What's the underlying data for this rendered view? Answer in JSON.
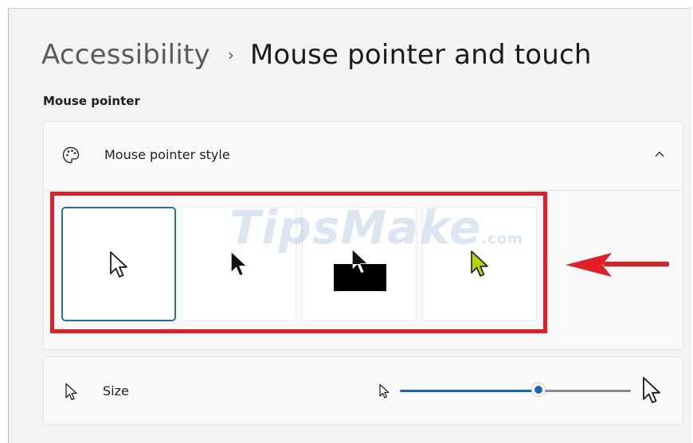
{
  "breadcrumb": {
    "parent": "Accessibility",
    "separator": "›",
    "current": "Mouse pointer and touch"
  },
  "section": {
    "label": "Mouse pointer"
  },
  "pointer_style": {
    "title": "Mouse pointer style",
    "icon": "palette-icon",
    "expanded": true,
    "options": [
      {
        "name": "white",
        "selected": true
      },
      {
        "name": "black",
        "selected": false
      },
      {
        "name": "inverted",
        "selected": false
      },
      {
        "name": "custom",
        "selected": false,
        "color": "#b5d900"
      }
    ]
  },
  "size": {
    "label": "Size",
    "icon": "pointer-icon",
    "slider_value_fraction": 0.6
  },
  "watermark": {
    "text": "TipsMake",
    "suffix": ".com"
  },
  "colors": {
    "accent": "#1a63b8",
    "annotation": "#e41e26"
  }
}
